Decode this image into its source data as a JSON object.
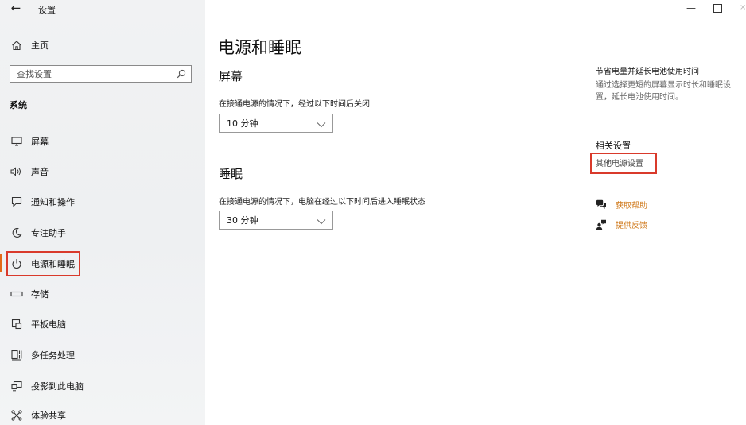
{
  "window": {
    "app_title": "设置",
    "back_glyph": "←",
    "minimize_glyph": "—",
    "close_glyph": "×"
  },
  "sidebar": {
    "home_label": "主页",
    "search_placeholder": "查找设置",
    "section_label": "系统",
    "items": [
      {
        "label": "屏幕",
        "icon": "display-icon"
      },
      {
        "label": "声音",
        "icon": "speaker-icon"
      },
      {
        "label": "通知和操作",
        "icon": "notification-icon"
      },
      {
        "label": "专注助手",
        "icon": "moon-icon"
      },
      {
        "label": "电源和睡眠",
        "icon": "power-icon",
        "selected": true
      },
      {
        "label": "存储",
        "icon": "storage-icon"
      },
      {
        "label": "平板电脑",
        "icon": "tablet-icon"
      },
      {
        "label": "多任务处理",
        "icon": "multitask-icon"
      },
      {
        "label": "投影到此电脑",
        "icon": "project-icon"
      },
      {
        "label": "体验共享",
        "icon": "share-icon"
      }
    ]
  },
  "main": {
    "title": "电源和睡眠",
    "screen": {
      "heading": "屏幕",
      "description": "在接通电源的情况下，经过以下时间后关闭",
      "value": "10 分钟"
    },
    "sleep": {
      "heading": "睡眠",
      "description": "在接通电源的情况下，电脑在经过以下时间后进入睡眠状态",
      "value": "30 分钟"
    }
  },
  "right_panel": {
    "battery_title": "节省电量并延长电池使用时间",
    "battery_text": "通过选择更短的屏幕显示时长和睡眠设置，延长电池使用时间。",
    "related_title": "相关设置",
    "related_link": "其他电源设置",
    "help_label": "获取帮助",
    "feedback_label": "提供反馈"
  },
  "colors": {
    "accent_orange": "#e36a18",
    "highlight_red": "#d93a2b",
    "link_orange": "#d07a1c"
  }
}
